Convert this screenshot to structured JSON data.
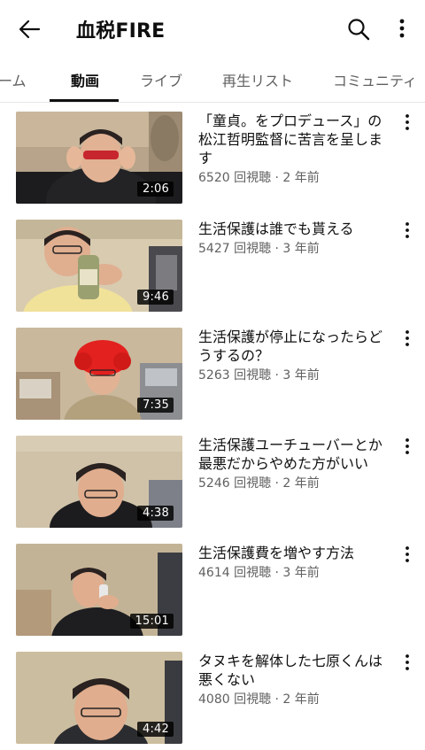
{
  "header": {
    "title": "血税FIRE",
    "icons": {
      "back": "back-arrow-icon",
      "search": "search-icon",
      "more": "more-vertical-icon"
    }
  },
  "tabs": [
    {
      "label": "ーム"
    },
    {
      "label": "動画",
      "active": true
    },
    {
      "label": "ライブ"
    },
    {
      "label": "再生リスト"
    },
    {
      "label": "コミュニティ"
    }
  ],
  "videos": [
    {
      "title": "「童貞。をプロデュース」の松江哲明監督に苦言を呈します",
      "meta": "6520 回視聴 · 2 年前",
      "duration": "2:06"
    },
    {
      "title": "生活保護は誰でも貰える",
      "meta": "5427 回視聴 · 3 年前",
      "duration": "9:46"
    },
    {
      "title": "生活保護が停止になったらどうするの？",
      "meta": "5263 回視聴 · 3 年前",
      "duration": "7:35"
    },
    {
      "title": "生活保護ユーチューバーとか最悪だからやめた方がいい",
      "meta": "5246 回視聴 · 2 年前",
      "duration": "4:38"
    },
    {
      "title": "生活保護費を増やす方法",
      "meta": "4614 回視聴 · 3 年前",
      "duration": "15:01"
    },
    {
      "title": "タヌキを解体した七原くんは悪くない",
      "meta": "4080 回視聴 · 2 年前",
      "duration": "4:42"
    }
  ]
}
